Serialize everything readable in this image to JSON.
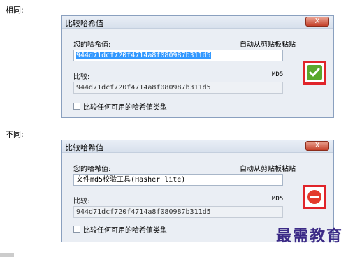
{
  "sections": {
    "same_label": "相同:",
    "diff_label": "不同:"
  },
  "window_same": {
    "title": "比较哈希值",
    "close": "X",
    "hash_label": "您的哈希值:",
    "paste_label": "自动从剪贴板粘贴",
    "hash_value": "944d71dcf720f4714a8f080987b311d5",
    "compare_label": "比较:",
    "algo": "MD5",
    "compare_value": "944d71dcf720f4714a8f080987b311d5",
    "checkbox_label": "比较任何可用的哈希值类型",
    "status_icon": "check-icon",
    "status_color": "#5aa82c"
  },
  "window_diff": {
    "title": "比较哈希值",
    "close": "X",
    "hash_label": "您的哈希值:",
    "paste_label": "自动从剪贴板粘贴",
    "hash_value": "文件md5校验工具(Hasher lite)",
    "compare_label": "比较:",
    "algo": "MD5",
    "compare_value": "944d71dcf720f4714a8f080987b311d5",
    "checkbox_label": "比较任何可用的哈希值类型",
    "status_icon": "no-entry-icon",
    "status_color": "#e33a2b"
  },
  "watermark": "最需教育"
}
